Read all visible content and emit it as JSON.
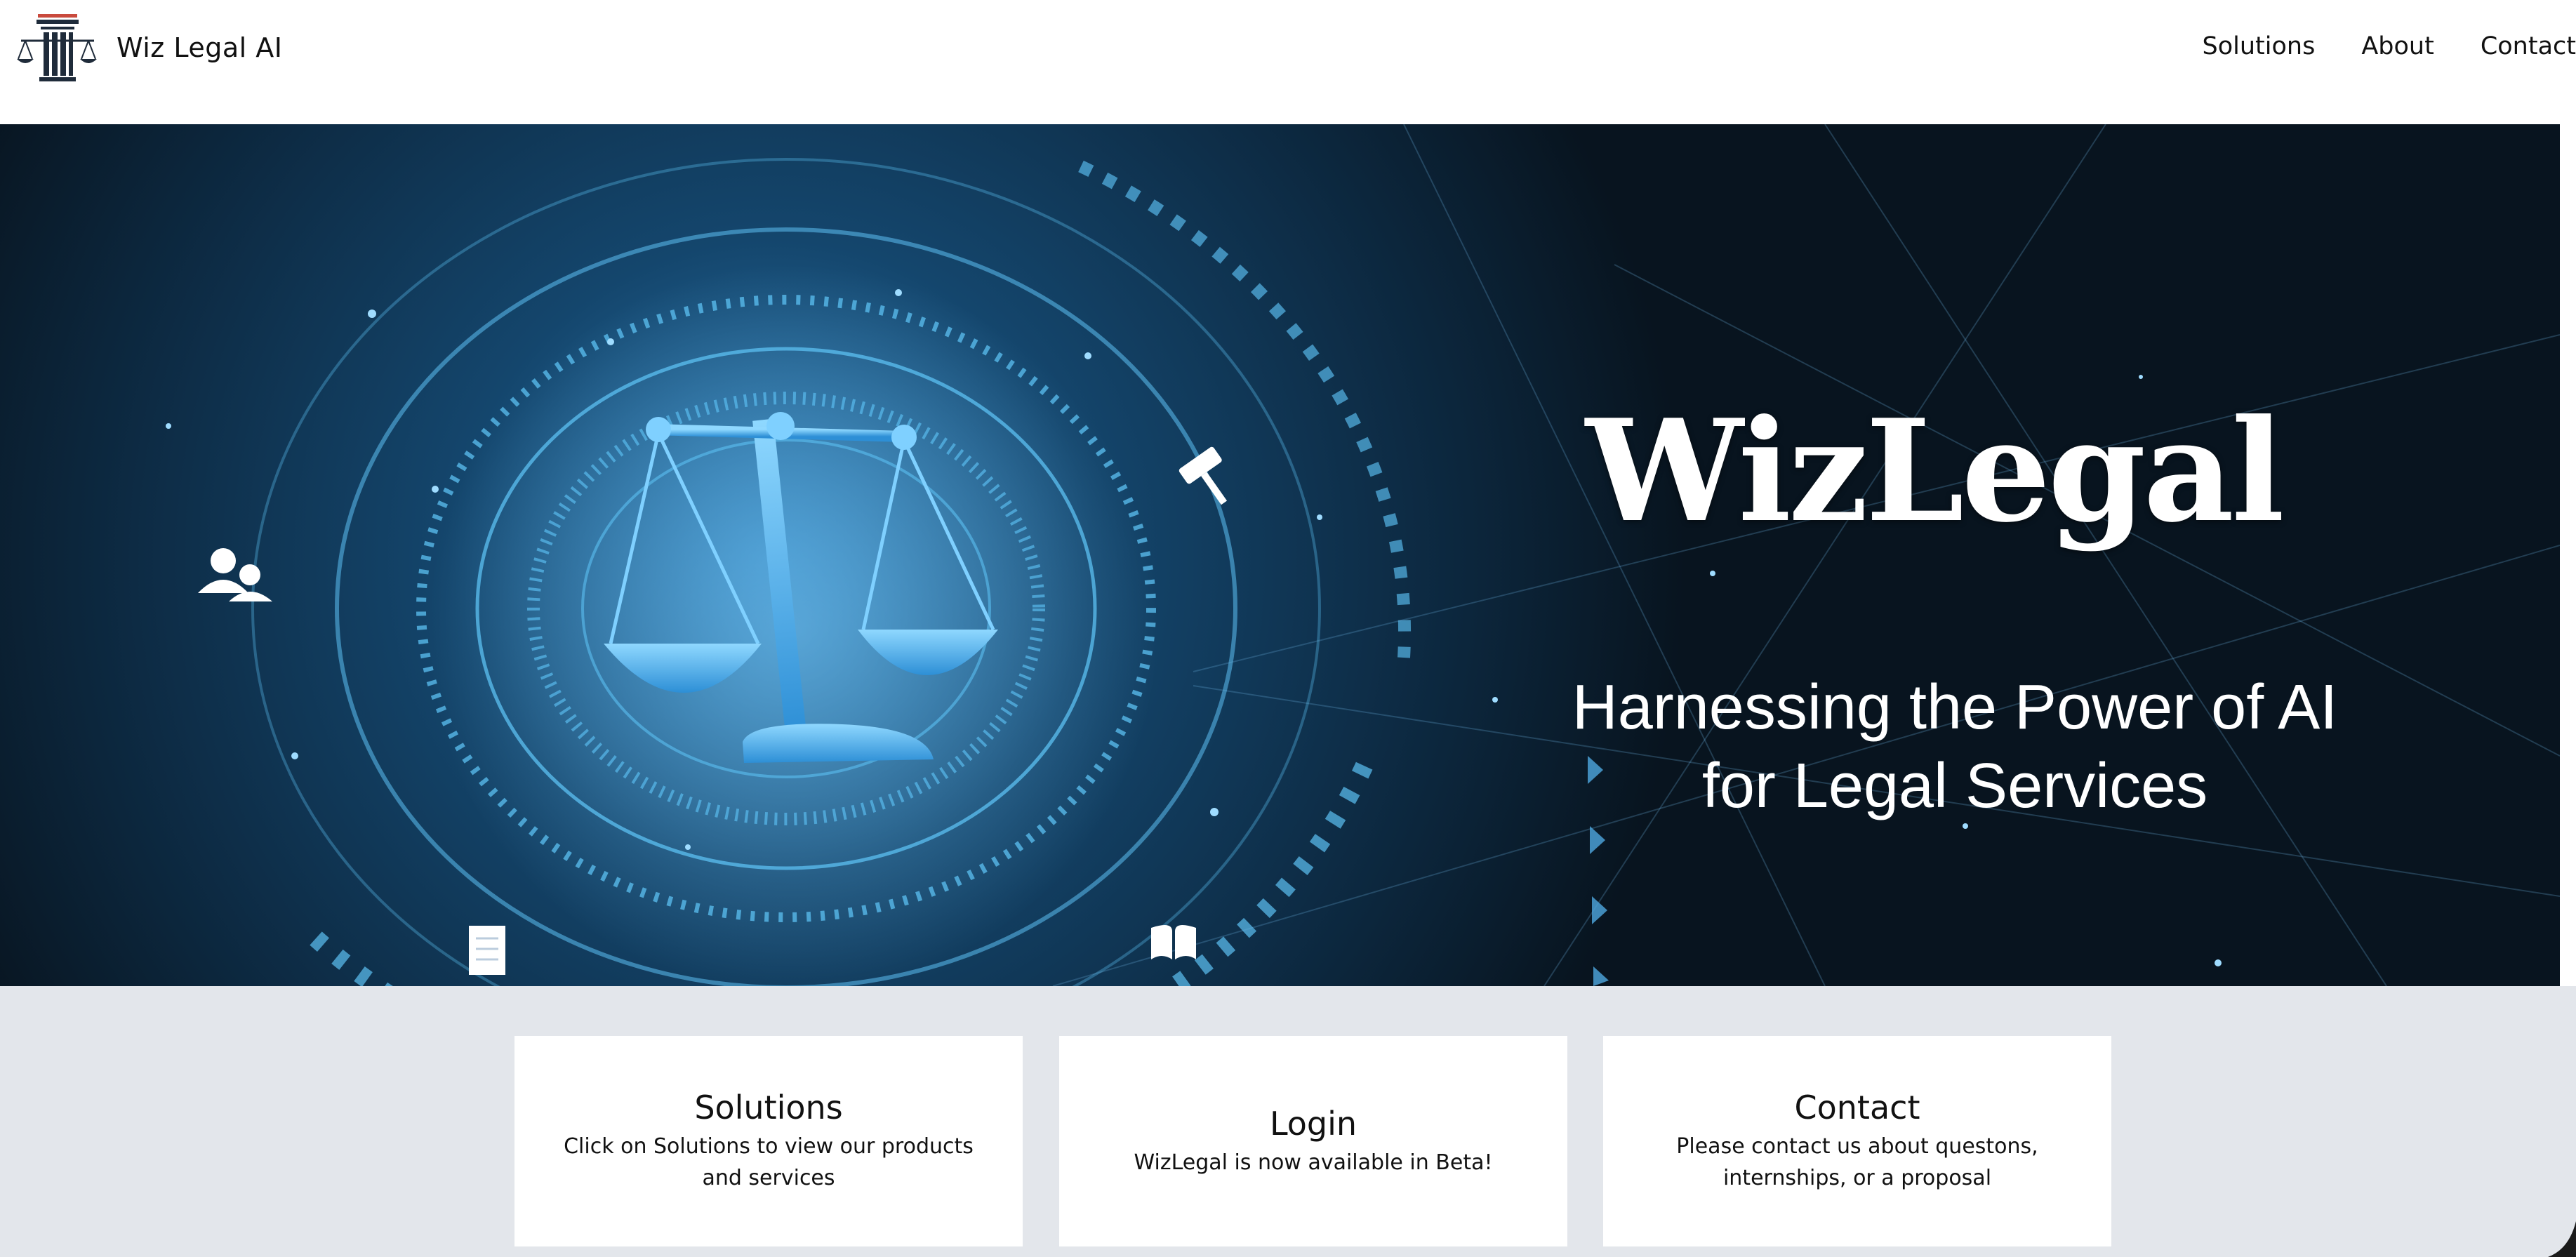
{
  "header": {
    "brand_title": "Wiz Legal AI",
    "nav": [
      {
        "label": "Solutions"
      },
      {
        "label": "About"
      },
      {
        "label": "Contact"
      }
    ]
  },
  "hero": {
    "title": "WizLegal",
    "subtitle_line1": "Harnessing the Power of AI",
    "subtitle_line2": "for Legal Services",
    "icons": [
      "scales-of-justice-icon",
      "users-icon",
      "gavel-icon",
      "document-icon",
      "book-icon"
    ]
  },
  "cards": [
    {
      "title": "Solutions",
      "description": "Click on Solutions to view our products and services"
    },
    {
      "title": "Login",
      "description": "WizLegal is now available in Beta!"
    },
    {
      "title": "Contact",
      "description": "Please contact us about questons, internships, or a proposal"
    }
  ],
  "colors": {
    "hero_bg": "#0b1c2a",
    "hero_glow": "#3fa9e6",
    "cards_bg": "#e3e6eb",
    "logo_dark": "#1f2b3a",
    "logo_accent": "#c94a3d"
  }
}
